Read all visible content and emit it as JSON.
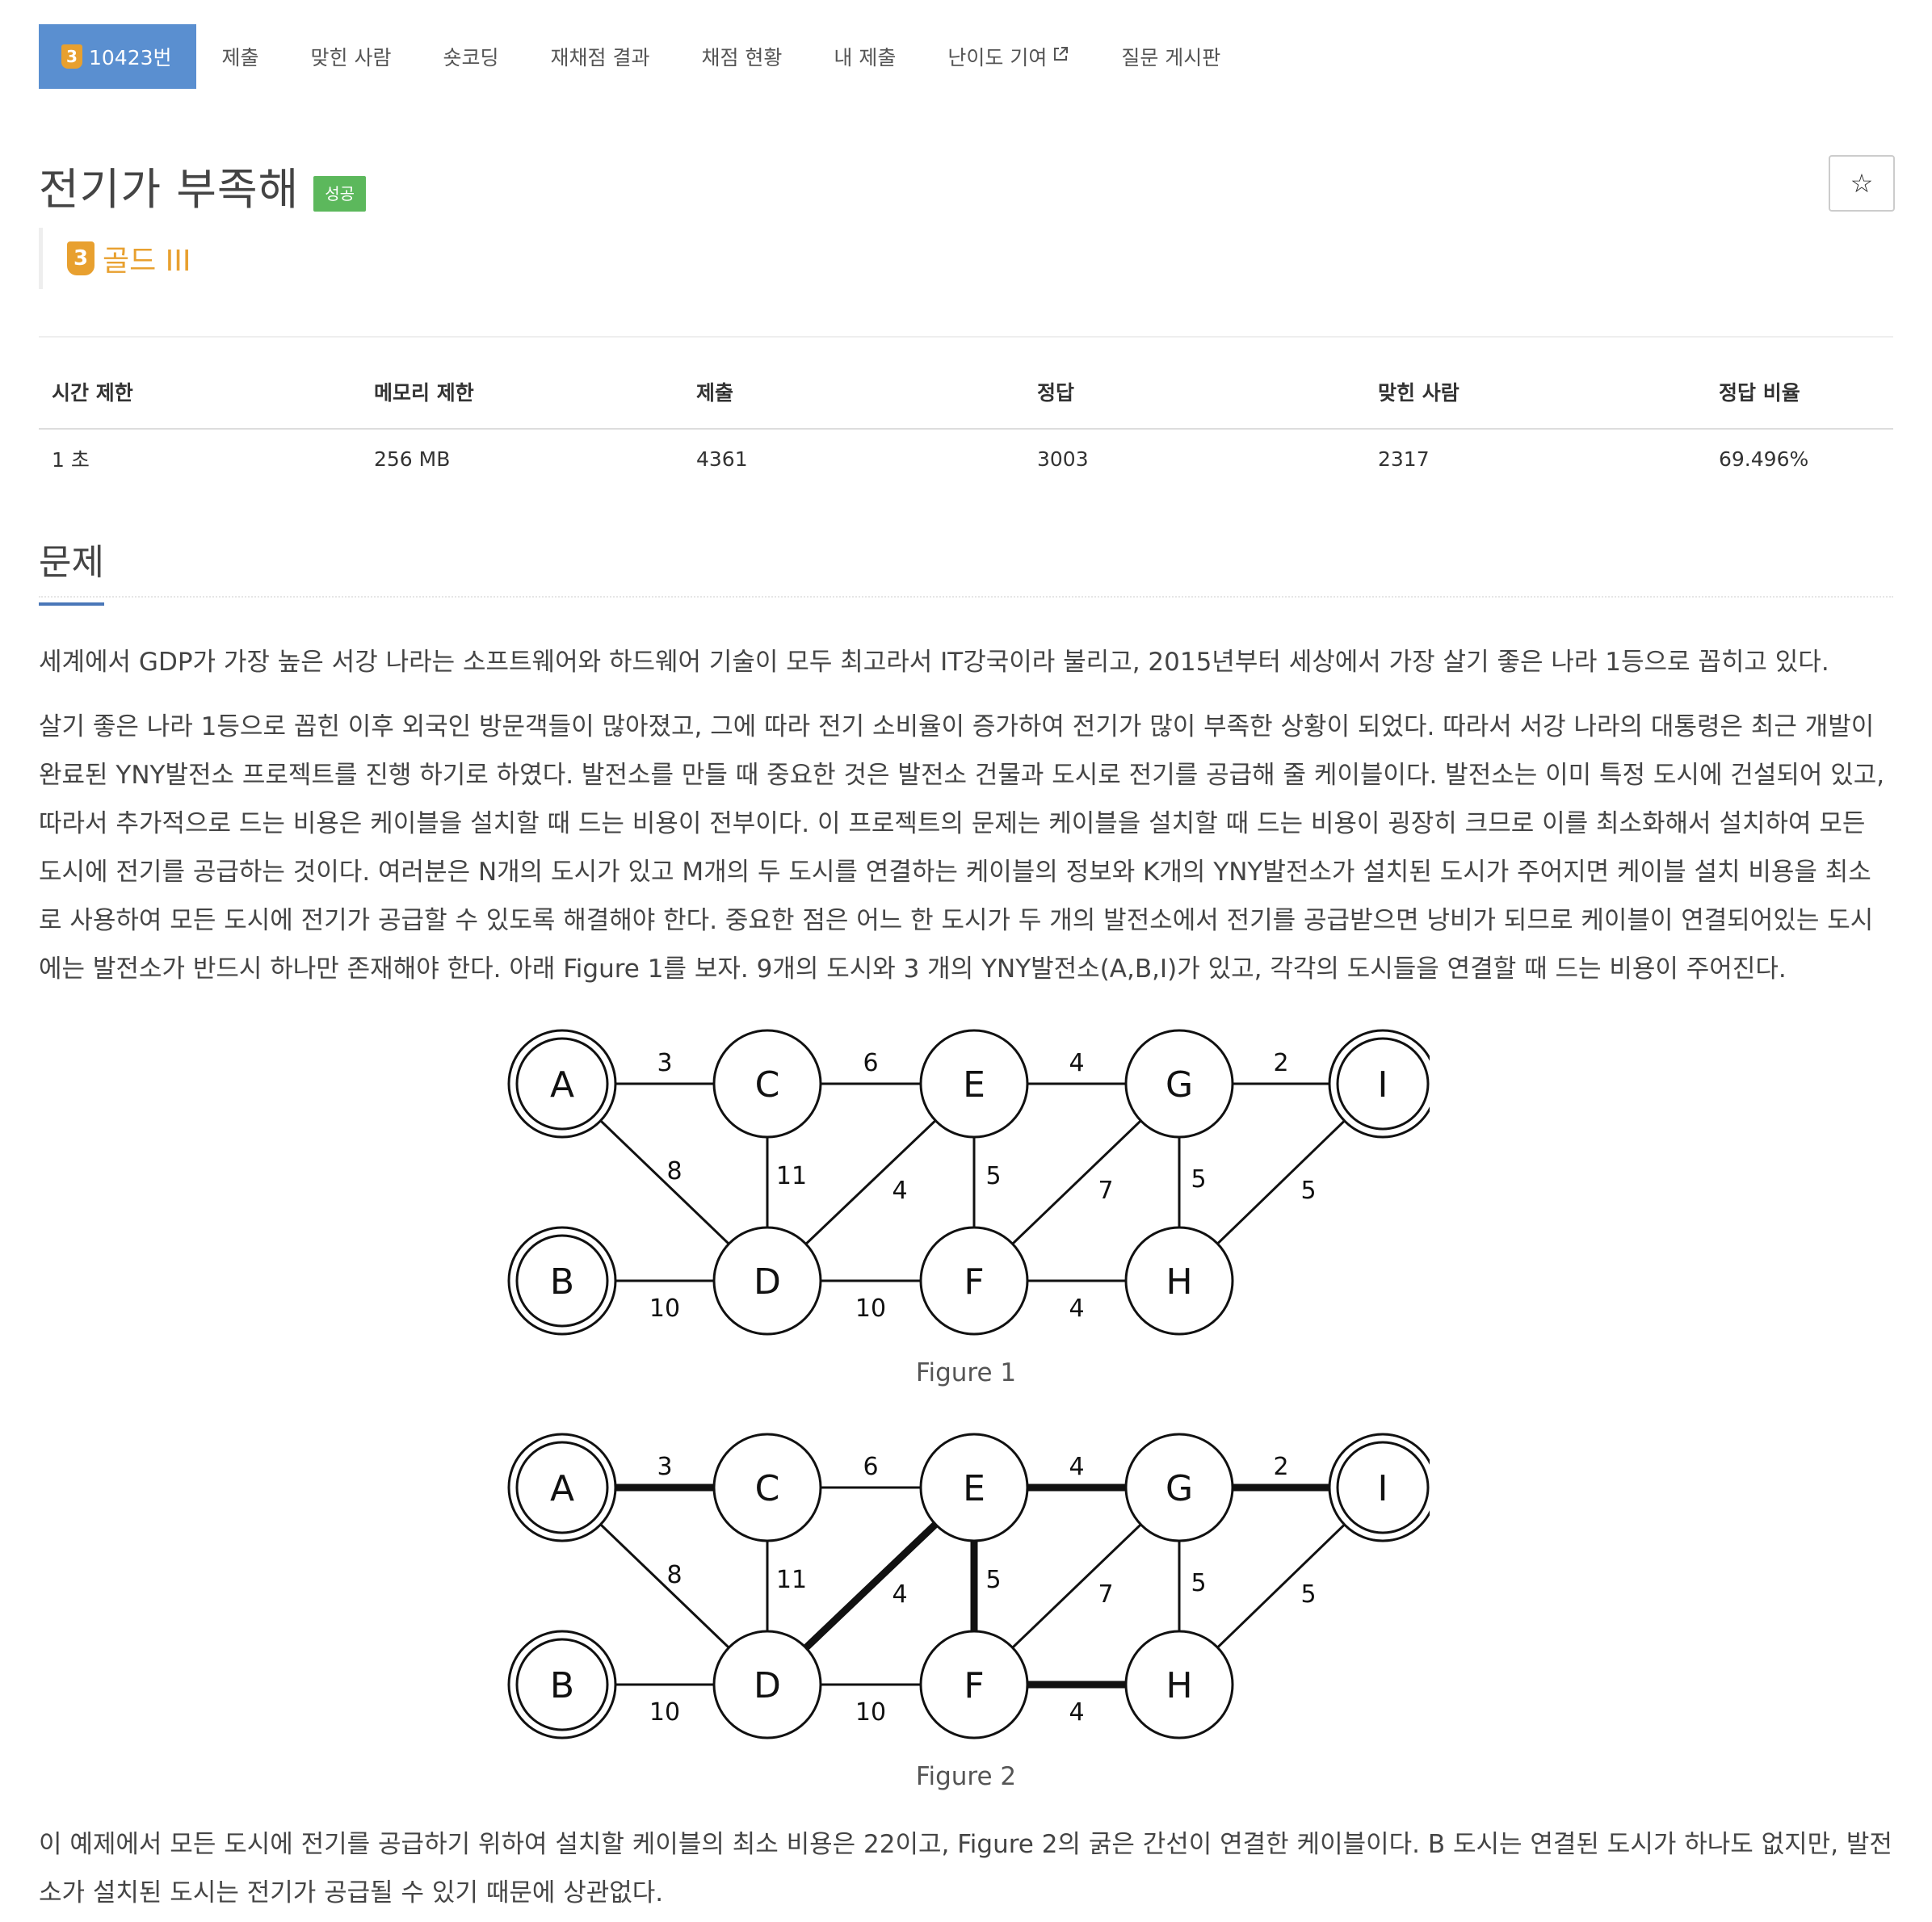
{
  "nav": {
    "tier_badge": "3",
    "problem_number": "10423번",
    "tabs": [
      "제출",
      "맞힌 사람",
      "숏코딩",
      "재채점 결과",
      "채점 현황",
      "내 제출",
      "난이도 기여",
      "질문 게시판"
    ]
  },
  "problem": {
    "title": "전기가 부족해",
    "result_badge": "성공",
    "star": "☆",
    "tier_badge": "3",
    "tier_label": "골드 III"
  },
  "info_table": {
    "headers": [
      "시간 제한",
      "메모리 제한",
      "제출",
      "정답",
      "맞힌 사람",
      "정답 비율"
    ],
    "values": [
      "1 초",
      "256 MB",
      "4361",
      "3003",
      "2317",
      "69.496%"
    ]
  },
  "section": {
    "title": "문제"
  },
  "body": {
    "p1": "세계에서 GDP가 가장 높은 서강 나라는 소프트웨어와 하드웨어 기술이 모두 최고라서 IT강국이라 불리고, 2015년부터 세상에서 가장 살기 좋은 나라 1등으로 꼽히고 있다.",
    "p2": "살기 좋은 나라 1등으로 꼽힌 이후 외국인 방문객들이 많아졌고, 그에 따라 전기 소비율이 증가하여 전기가 많이 부족한 상황이 되었다. 따라서 서강 나라의 대통령은 최근 개발이 완료된 YNY발전소 프로젝트를 진행 하기로 하였다. 발전소를 만들 때 중요한 것은 발전소 건물과 도시로 전기를 공급해 줄 케이블이다. 발전소는 이미 특정 도시에 건설되어 있고, 따라서 추가적으로 드는 비용은 케이블을 설치할 때 드는 비용이 전부이다. 이 프로젝트의 문제는 케이블을 설치할 때 드는 비용이 굉장히 크므로 이를 최소화해서 설치하여 모든 도시에 전기를 공급하는 것이다. 여러분은 N개의 도시가 있고 M개의 두 도시를 연결하는 케이블의 정보와 K개의 YNY발전소가 설치된 도시가 주어지면 케이블 설치 비용을 최소로 사용하여 모든 도시에 전기가 공급할 수 있도록 해결해야 한다. 중요한 점은 어느 한 도시가 두 개의 발전소에서 전기를 공급받으면 낭비가 되므로 케이블이 연결되어있는 도시에는 발전소가 반드시 하나만 존재해야 한다. 아래 Figure 1를 보자. 9개의 도시와 3 개의 YNY발전소(A,B,I)가 있고, 각각의 도시들을 연결할 때 드는 비용이 주어진다.",
    "p3": "이 예제에서 모든 도시에 전기를 공급하기 위하여 설치할 케이블의 최소 비용은 22이고, Figure 2의 굵은 간선이 연결한 케이블이다. B 도시는 연결된 도시가 하나도 없지만, 발전소가 설치된 도시는 전기가 공급될 수 있기 때문에 상관없다."
  },
  "figures": {
    "captions": [
      "Figure 1",
      "Figure 2"
    ],
    "nodes": [
      {
        "id": "A",
        "label": "A",
        "power_plant": true
      },
      {
        "id": "B",
        "label": "B",
        "power_plant": true
      },
      {
        "id": "C",
        "label": "C",
        "power_plant": false
      },
      {
        "id": "D",
        "label": "D",
        "power_plant": false
      },
      {
        "id": "E",
        "label": "E",
        "power_plant": false
      },
      {
        "id": "F",
        "label": "F",
        "power_plant": false
      },
      {
        "id": "G",
        "label": "G",
        "power_plant": false
      },
      {
        "id": "H",
        "label": "H",
        "power_plant": false
      },
      {
        "id": "I",
        "label": "I",
        "power_plant": true
      }
    ],
    "edges": [
      {
        "from": "A",
        "to": "C",
        "weight": "3",
        "bold_in_fig2": true
      },
      {
        "from": "C",
        "to": "E",
        "weight": "6",
        "bold_in_fig2": false
      },
      {
        "from": "E",
        "to": "G",
        "weight": "4",
        "bold_in_fig2": true
      },
      {
        "from": "G",
        "to": "I",
        "weight": "2",
        "bold_in_fig2": true
      },
      {
        "from": "A",
        "to": "D",
        "weight": "8",
        "bold_in_fig2": false
      },
      {
        "from": "C",
        "to": "D",
        "weight": "11",
        "bold_in_fig2": false
      },
      {
        "from": "E",
        "to": "D",
        "weight": "4",
        "bold_in_fig2": true
      },
      {
        "from": "E",
        "to": "F",
        "weight": "5",
        "bold_in_fig2": true
      },
      {
        "from": "G",
        "to": "F",
        "weight": "7",
        "bold_in_fig2": false
      },
      {
        "from": "G",
        "to": "H",
        "weight": "5",
        "bold_in_fig2": false
      },
      {
        "from": "I",
        "to": "H",
        "weight": "5",
        "bold_in_fig2": false
      },
      {
        "from": "B",
        "to": "D",
        "weight": "10",
        "bold_in_fig2": false
      },
      {
        "from": "D",
        "to": "F",
        "weight": "10",
        "bold_in_fig2": false
      },
      {
        "from": "F",
        "to": "H",
        "weight": "4",
        "bold_in_fig2": true
      }
    ]
  },
  "colors": {
    "nav_active": "#5a8fd0",
    "tier_gold": "#e8a02f",
    "result_success": "#5cb85c",
    "section_underline": "#4a77b8"
  }
}
